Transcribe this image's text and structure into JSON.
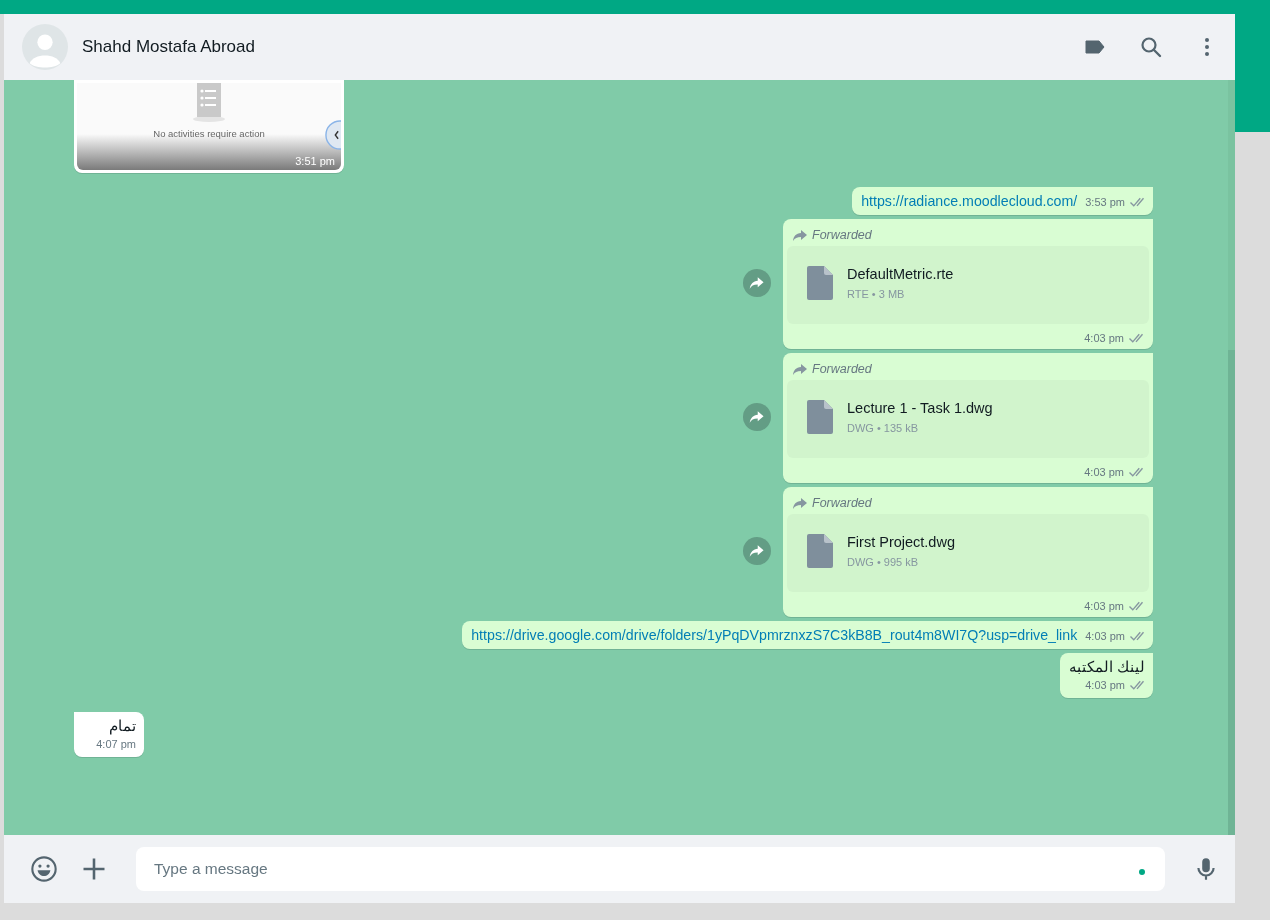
{
  "chat_header": {
    "contact_name": "Shahd Mostafa Abroad"
  },
  "messages": [
    {
      "kind": "image",
      "outgoing": false,
      "caption": "No activities require action",
      "time": "3:51 pm"
    },
    {
      "kind": "link",
      "outgoing": true,
      "text": "https://radiance.moodlecloud.com/",
      "time": "3:53 pm",
      "read": true
    },
    {
      "kind": "file",
      "outgoing": true,
      "forwarded": true,
      "forwarded_label": "Forwarded",
      "file_name": "DefaultMetric.rte",
      "file_info": "RTE • 3 MB",
      "time": "4:03 pm",
      "read": true
    },
    {
      "kind": "file",
      "outgoing": true,
      "forwarded": true,
      "forwarded_label": "Forwarded",
      "file_name": "Lecture 1 - Task 1.dwg",
      "file_info": "DWG • 135 kB",
      "time": "4:03 pm",
      "read": true
    },
    {
      "kind": "file",
      "outgoing": true,
      "forwarded": true,
      "forwarded_label": "Forwarded",
      "file_name": "First Project.dwg",
      "file_info": "DWG • 995 kB",
      "time": "4:03 pm",
      "read": true
    },
    {
      "kind": "link",
      "outgoing": true,
      "text": "https://drive.google.com/drive/folders/1yPqDVpmrznxzS7C3kB8B_rout4m8WI7Q?usp=drive_link",
      "time": "4:03 pm",
      "read": true
    },
    {
      "kind": "text",
      "outgoing": true,
      "text": "لينك المكتبه",
      "time": "4:03 pm",
      "read": true
    },
    {
      "kind": "text",
      "outgoing": false,
      "text": "تمام",
      "time": "4:07 pm"
    }
  ],
  "composer": {
    "placeholder": "Type a message"
  }
}
